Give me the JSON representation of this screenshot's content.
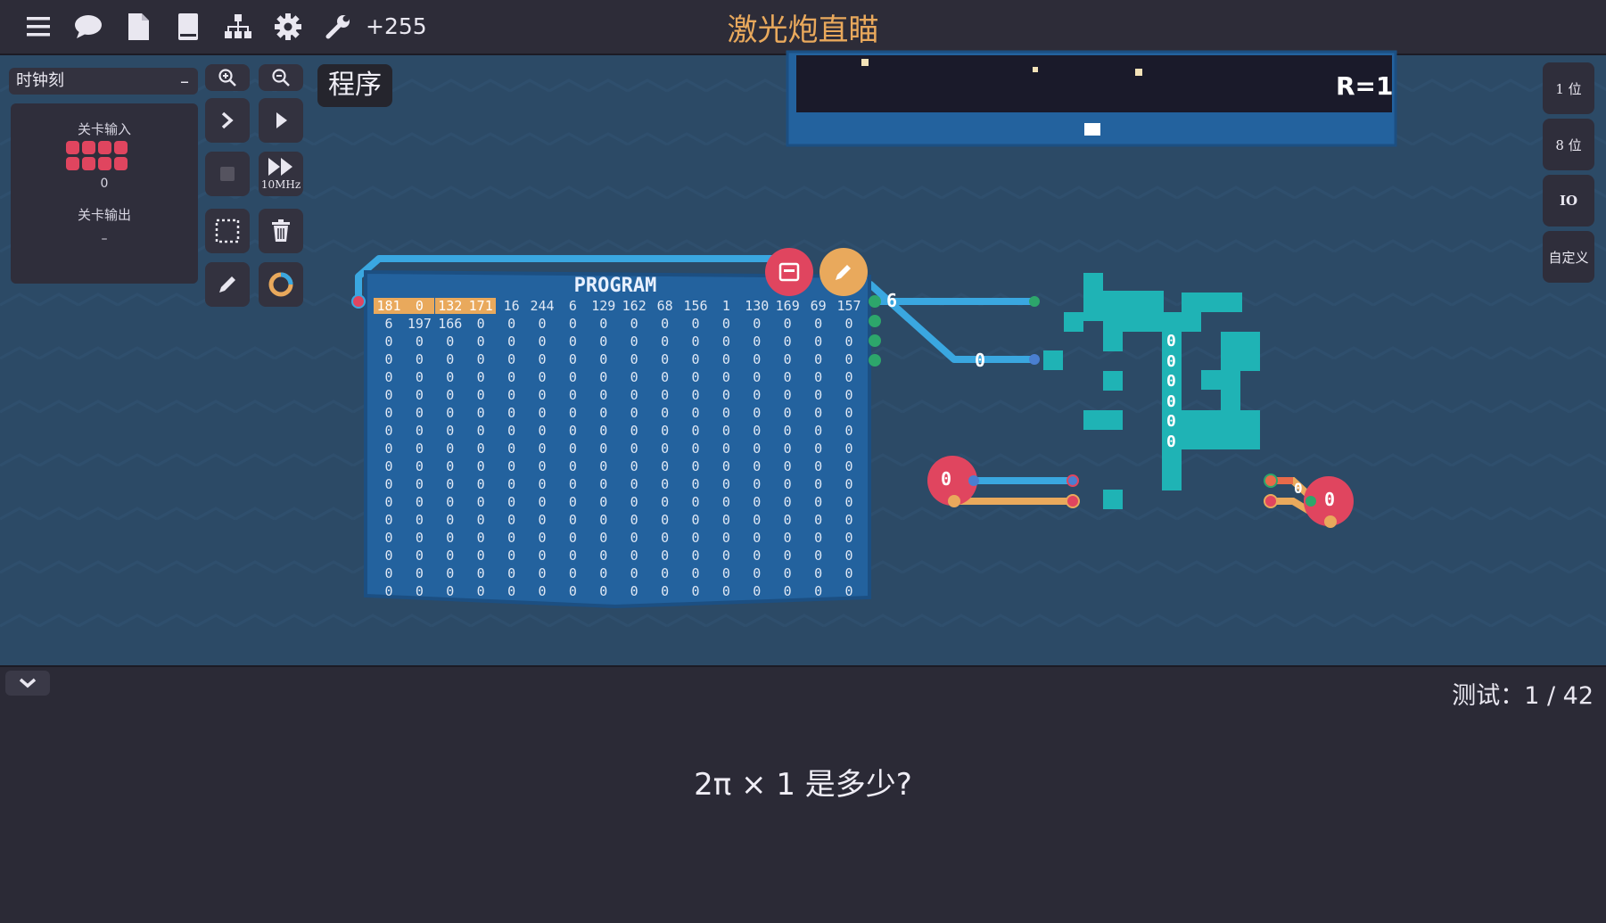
{
  "topbar": {
    "icons": [
      "menu-icon",
      "chat-icon",
      "file-icon",
      "book-icon",
      "hierarchy-icon",
      "gear-icon",
      "wrench-icon"
    ],
    "score": "+255",
    "title": "激光炮直瞄"
  },
  "sidebar": {
    "clock_select": "时钟刻",
    "clock_dash": "–",
    "level_input_label": "关卡输入",
    "level_input_value": "0",
    "level_output_label": "关卡输出",
    "level_output_value": "–"
  },
  "controls": {
    "speed_label": "10MHz",
    "program_tag": "程序"
  },
  "right_tabs": [
    "1 位",
    "8 位",
    "IO",
    "自定义"
  ],
  "display": {
    "text": "R=1"
  },
  "program": {
    "title": "PROGRAM",
    "row0": [
      "181",
      "0",
      "132",
      "171",
      "16",
      "244",
      "6",
      "129",
      "162",
      "68",
      "156",
      "1",
      "130",
      "169",
      "69",
      "157"
    ],
    "row1": [
      "6",
      "197",
      "166",
      "0",
      "0",
      "0",
      "0",
      "0",
      "0",
      "0",
      "0",
      "0",
      "0",
      "0",
      "0",
      "0"
    ],
    "zero_rows": 15,
    "highlight_count": 4,
    "output_value": "6",
    "wire_value": "0"
  },
  "components": {
    "decoder_values": [
      "0",
      "0",
      "0",
      "0",
      "0",
      "0"
    ],
    "red_a": "0",
    "red_b": "0",
    "small_value": "0"
  },
  "colors": {
    "accent_orange": "#e9a95c",
    "board_blue": "#2c4a66",
    "program_blue": "#23629e",
    "teal": "#1fb3b5",
    "red": "#e0455f"
  },
  "footer": {
    "test_count": "测试：1 / 42",
    "question": "2π × 1 是多少?"
  }
}
